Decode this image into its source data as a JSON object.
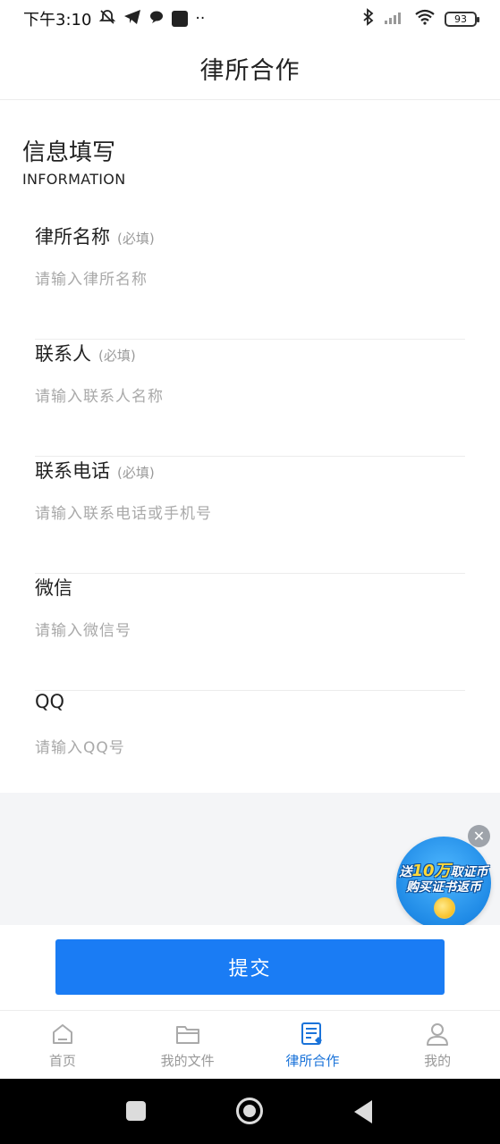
{
  "status_bar": {
    "time": "下午3:10",
    "battery": "93"
  },
  "header": {
    "title": "律所合作"
  },
  "section": {
    "title": "信息填写",
    "subtitle": "INFORMATION"
  },
  "fields": [
    {
      "label": "律所名称",
      "required": "(必填)",
      "placeholder": "请输入律所名称",
      "value": ""
    },
    {
      "label": "联系人",
      "required": "(必填)",
      "placeholder": "请输入联系人名称",
      "value": ""
    },
    {
      "label": "联系电话",
      "required": "(必填)",
      "placeholder": "请输入联系电话或手机号",
      "value": ""
    },
    {
      "label": "微信",
      "required": "",
      "placeholder": "请输入微信号",
      "value": ""
    },
    {
      "label": "QQ",
      "required": "",
      "placeholder": "请输入QQ号",
      "value": ""
    }
  ],
  "promo": {
    "line1_prefix": "送",
    "line1_number": "10万",
    "line1_suffix": "取证币",
    "line2": "购买证书返币"
  },
  "submit": {
    "label": "提交"
  },
  "tabs": [
    {
      "label": "首页",
      "icon": "home-icon"
    },
    {
      "label": "我的文件",
      "icon": "folder-icon"
    },
    {
      "label": "律所合作",
      "icon": "cooperation-doc-icon",
      "active": true
    },
    {
      "label": "我的",
      "icon": "user-icon"
    }
  ],
  "colors": {
    "accent": "#1a7cf4",
    "tab_active": "#1a73d9",
    "tab_inactive": "#999999",
    "page_grey": "#f4f5f7"
  }
}
